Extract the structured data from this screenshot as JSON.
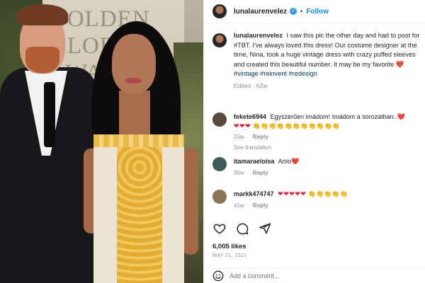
{
  "photo": {
    "backdrop_text": "GOLDEN GLOBE AWARDS"
  },
  "post": {
    "username": "lunalaurenvelez",
    "verified_icon": "verified-badge-icon",
    "separator": "•",
    "follow_label": "Follow",
    "caption": {
      "username": "lunalaurenvelez",
      "text": "I saw this pic the other day and had to post for #TBT. I've always loved this dress! Our costume designer at the time, Nina, took a huge vintage dress with crazy puffed sleeves and created this beautiful number. It may be my favorite",
      "heart": "❤️",
      "hashtags": "#vintage #reinvent #redesign",
      "meta": "Edited · 62w"
    },
    "comments": [
      {
        "username": "fekete6944",
        "text": "Egyszerűen imádom! Imádom a sorozatban..❤️",
        "emoji_hearts": "❤❤❤",
        "emoji_hands": "👏👏👏👏👏👏👏👏👏👏👏",
        "time": "20w",
        "reply": "Reply",
        "see_translation": "See translation",
        "avatar_color": "#5c4a3c"
      },
      {
        "username": "itamaraeloisa",
        "text": "Amo❤️",
        "time": "35w",
        "reply": "Reply",
        "avatar_color": "#3f5a5a"
      },
      {
        "username": "markk474747",
        "emoji_hearts": "❤❤❤❤❤",
        "emoji_hands": "👏👏👏👏👏",
        "time": "41w",
        "reply": "Reply",
        "avatar_color": "#8a7356"
      }
    ],
    "actions": {
      "like_icon": "heart-outline-icon",
      "comment_icon": "comment-bubble-icon",
      "share_icon": "paper-plane-icon"
    },
    "likes": "6,005 likes",
    "date": "MAY 21, 2021",
    "add_comment_placeholder": "Add a comment..."
  },
  "colors": {
    "link": "#0095f6",
    "hashtag": "#00376b",
    "muted": "#8e8e8e",
    "heart": "#ed4956"
  }
}
